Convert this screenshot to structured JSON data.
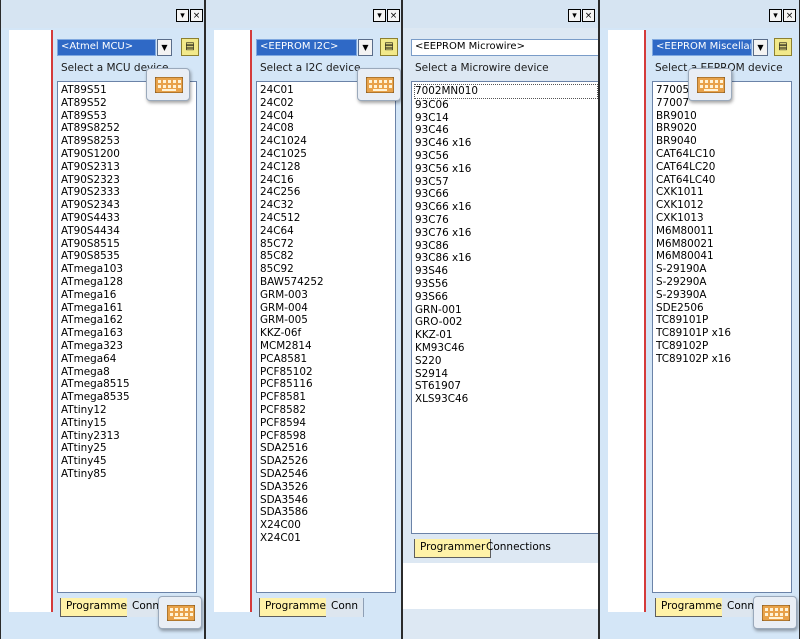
{
  "panels": [
    {
      "combo": "<Atmel MCU>",
      "hint": "Select a MCU device",
      "items": [
        "AT89S51",
        "AT89S52",
        "AT89S53",
        "AT89S8252",
        "AT89S8253",
        "AT90S1200",
        "AT90S2313",
        "AT90S2323",
        "AT90S2333",
        "AT90S2343",
        "AT90S4433",
        "AT90S4434",
        "AT90S8515",
        "AT90S8535",
        "ATmega103",
        "ATmega128",
        "ATmega16",
        "ATmega161",
        "ATmega162",
        "ATmega163",
        "ATmega323",
        "ATmega64",
        "ATmega8",
        "ATmega8515",
        "ATmega8535",
        "ATtiny12",
        "ATtiny15",
        "ATtiny2313",
        "ATtiny25",
        "ATtiny45",
        "ATtiny85"
      ],
      "tab_programmer": "Programmer",
      "tab_connections": "Conn"
    },
    {
      "combo": "<EEPROM I2C>",
      "hint": "Select a I2C device",
      "items": [
        "24C01",
        "24C02",
        "24C04",
        "24C08",
        "24C1024",
        "24C1025",
        "24C128",
        "24C16",
        "24C256",
        "24C32",
        "24C512",
        "24C64",
        "85C72",
        "85C82",
        "85C92",
        "BAW574252",
        "GRM-003",
        "GRM-004",
        "GRM-005",
        "KKZ-06f",
        "MCM2814",
        "PCA8581",
        "PCF85102",
        "PCF85116",
        "PCF8581",
        "PCF8582",
        "PCF8594",
        "PCF8598",
        "SDA2516",
        "SDA2526",
        "SDA2546",
        "SDA3526",
        "SDA3546",
        "SDA3586",
        "X24C00",
        "X24C01"
      ],
      "tab_programmer": "Programmer",
      "tab_connections": "Conn"
    },
    {
      "combo": "<EEPROM Microwire>",
      "hint": "Select a Microwire device",
      "items": [
        "7002MN010",
        "93C06",
        "93C14",
        "93C46",
        "93C46 x16",
        "93C56",
        "93C56 x16",
        "93C57",
        "93C66",
        "93C66 x16",
        "93C76",
        "93C76 x16",
        "93C86",
        "93C86 x16",
        "93S46",
        "93S56",
        "93S66",
        "GRN-001",
        "GRO-002",
        "KKZ-01",
        "KM93C46",
        "S220",
        "S2914",
        "ST61907",
        "XLS93C46"
      ],
      "tab_programmer": "Programmer",
      "tab_connections": "Connections"
    },
    {
      "combo": "<EEPROM Miscellar",
      "hint": "Select a EEPROM device",
      "items": [
        "77005",
        "77007",
        "BR9010",
        "BR9020",
        "BR9040",
        "CAT64LC10",
        "CAT64LC20",
        "CAT64LC40",
        "CXK1011",
        "CXK1012",
        "CXK1013",
        "M6M80011",
        "M6M80021",
        "M6M80041",
        "S-29190A",
        "S-29290A",
        "S-29390A",
        "SDE2506",
        "TC89101P",
        "TC89101P x16",
        "TC89102P",
        "TC89102P x16"
      ],
      "tab_programmer": "Programmer",
      "tab_connections": "Conn"
    }
  ],
  "icons": {
    "pin": "▾",
    "close": "×",
    "dropdown": "▼",
    "folder": "folder-icon",
    "keyboard": "keyboard-icon"
  }
}
